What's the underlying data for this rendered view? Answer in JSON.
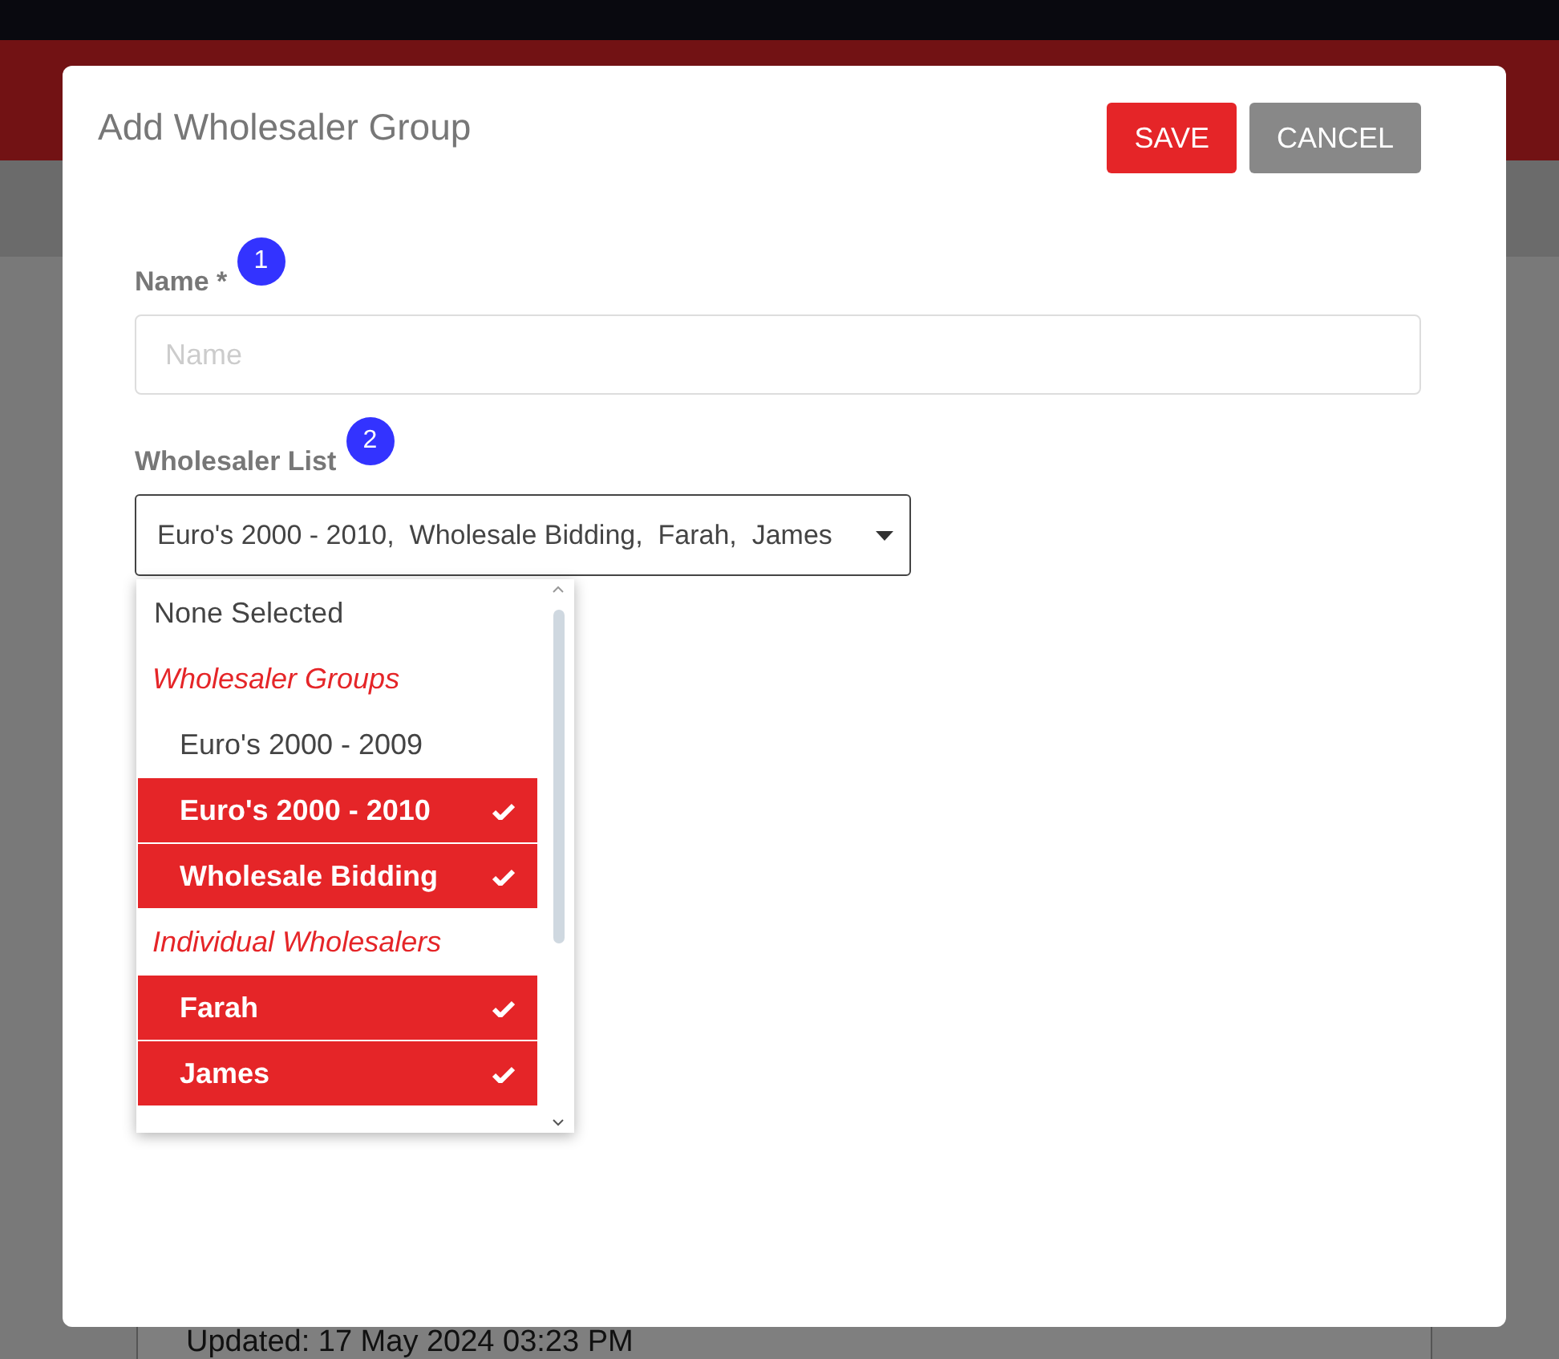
{
  "background": {
    "status_select": "Updated: 17 May 2024 03:23 PM"
  },
  "dialog": {
    "title": "Add Wholesaler Group",
    "buttons": [
      {
        "label": "SAVE",
        "kind": "primary"
      },
      {
        "label": "CANCEL",
        "kind": "secondary"
      }
    ],
    "fields": [
      {
        "label": "Name *",
        "badge": "1",
        "placeholder": "Name"
      },
      {
        "label": "Wholesaler List",
        "badge": "2",
        "value": "Euro's 2000 - 2010,  Wholesale Bidding,  Farah,  James"
      }
    ],
    "dropdown": {
      "items": [
        {
          "kind": "option",
          "label": "None Selected",
          "selected": false,
          "indent": false
        },
        {
          "kind": "header",
          "label": "Wholesaler Groups"
        },
        {
          "kind": "option",
          "label": "Euro's 2000 - 2009",
          "selected": false,
          "indent": true
        },
        {
          "kind": "option",
          "label": "Euro's 2000 - 2010",
          "selected": true,
          "indent": true
        },
        {
          "kind": "option",
          "label": "Wholesale Bidding",
          "selected": true,
          "indent": true
        },
        {
          "kind": "header",
          "label": "Individual Wholesalers"
        },
        {
          "kind": "option",
          "label": "Farah",
          "selected": true,
          "indent": true
        },
        {
          "kind": "option",
          "label": "James",
          "selected": true,
          "indent": true
        }
      ]
    }
  }
}
